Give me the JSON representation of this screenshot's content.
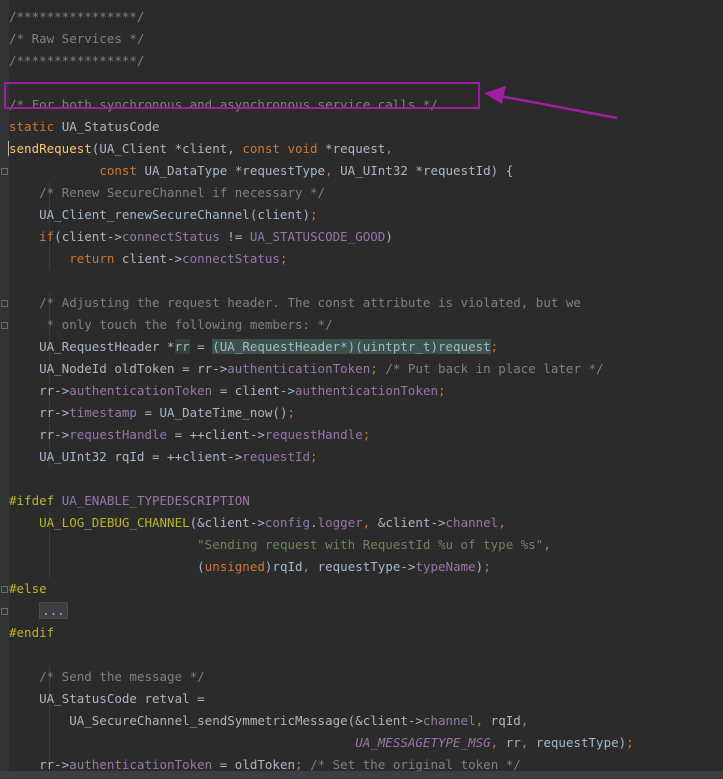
{
  "editor": {
    "lines": [
      [
        [
          "c",
          "/****************/"
        ]
      ],
      [
        [
          "c",
          "/* Raw Services */"
        ]
      ],
      [
        [
          "c",
          "/****************/"
        ]
      ],
      [],
      [
        [
          "c",
          "/* For both synchronous and asynchronous service calls */"
        ]
      ],
      [
        [
          "k",
          "static "
        ],
        [
          "t",
          "UA_StatusCode"
        ]
      ],
      [
        [
          "caret",
          ""
        ],
        [
          "fn",
          "sendRequest"
        ],
        [
          "t",
          "(UA_Client *client, "
        ],
        [
          "k",
          "const void "
        ],
        [
          "t",
          "*request"
        ],
        [
          "k",
          ","
        ]
      ],
      [
        [
          "t",
          "            "
        ],
        [
          "k",
          "const "
        ],
        [
          "t",
          "UA_DataType *requestType"
        ],
        [
          "k",
          ", "
        ],
        [
          "t",
          "UA_UInt32 *requestId) {"
        ]
      ],
      [
        [
          "t",
          "    "
        ],
        [
          "c",
          "/* Renew SecureChannel if necessary */"
        ]
      ],
      [
        [
          "t",
          "    UA_Client_renewSecureChannel(client)"
        ],
        [
          "k",
          ";"
        ]
      ],
      [
        [
          "t",
          "    "
        ],
        [
          "k",
          "if"
        ],
        [
          "t",
          "(client->"
        ],
        [
          "m",
          "connectStatus"
        ],
        [
          "t",
          " != "
        ],
        [
          "m",
          "UA_STATUSCODE_GOOD"
        ],
        [
          "t",
          ")"
        ]
      ],
      [
        [
          "t",
          "        "
        ],
        [
          "k",
          "return "
        ],
        [
          "t",
          "client->"
        ],
        [
          "m",
          "connectStatus"
        ],
        [
          "k",
          ";"
        ]
      ],
      [],
      [
        [
          "t",
          "    "
        ],
        [
          "c",
          "/* Adjusting the request header. The const attribute is violated, but we"
        ]
      ],
      [
        [
          "t",
          "    "
        ],
        [
          "c",
          " * only touch the following members: */"
        ]
      ],
      [
        [
          "t",
          "    UA_RequestHeader *"
        ],
        [
          "hl",
          "rr"
        ],
        [
          "t",
          " = "
        ],
        [
          "hl2",
          "(UA_RequestHeader*)(uintptr_t)request"
        ],
        [
          "k",
          ";"
        ]
      ],
      [
        [
          "t",
          "    UA_NodeId oldToken = rr->"
        ],
        [
          "m",
          "authenticationToken"
        ],
        [
          "k",
          "; "
        ],
        [
          "c",
          "/* Put back in place later */"
        ]
      ],
      [
        [
          "t",
          "    rr->"
        ],
        [
          "m",
          "authenticationToken"
        ],
        [
          "t",
          " = client->"
        ],
        [
          "m",
          "authenticationToken"
        ],
        [
          "k",
          ";"
        ]
      ],
      [
        [
          "t",
          "    rr->"
        ],
        [
          "m",
          "timestamp"
        ],
        [
          "t",
          " = UA_DateTime_now()"
        ],
        [
          "k",
          ";"
        ]
      ],
      [
        [
          "t",
          "    rr->"
        ],
        [
          "m",
          "requestHandle"
        ],
        [
          "t",
          " = ++client->"
        ],
        [
          "m",
          "requestHandle"
        ],
        [
          "k",
          ";"
        ]
      ],
      [
        [
          "t",
          "    UA_UInt32 rqId = ++client->"
        ],
        [
          "m",
          "requestId"
        ],
        [
          "k",
          ";"
        ]
      ],
      [],
      [
        [
          "pp",
          "#ifdef "
        ],
        [
          "m",
          "UA_ENABLE_TYPEDESCRIPTION"
        ]
      ],
      [
        [
          "t",
          "    "
        ],
        [
          "pp",
          "UA_LOG_DEBUG_CHANNEL"
        ],
        [
          "t",
          "(&client->"
        ],
        [
          "m",
          "config"
        ],
        [
          "t",
          "."
        ],
        [
          "m",
          "logger"
        ],
        [
          "k",
          ", "
        ],
        [
          "t",
          "&client->"
        ],
        [
          "m",
          "channel"
        ],
        [
          "k",
          ","
        ]
      ],
      [
        [
          "t",
          "                         "
        ],
        [
          "s",
          "\"Sending request with RequestId %u of type %s\""
        ],
        [
          "k",
          ","
        ]
      ],
      [
        [
          "t",
          "                         ("
        ],
        [
          "k",
          "unsigned"
        ],
        [
          "t",
          ")rqId"
        ],
        [
          "k",
          ", "
        ],
        [
          "t",
          "requestType->"
        ],
        [
          "m",
          "typeName"
        ],
        [
          "t",
          ")"
        ],
        [
          "k",
          ";"
        ]
      ],
      [
        [
          "pp",
          "#else"
        ]
      ],
      [
        [
          "t",
          "    "
        ],
        [
          "ell",
          "..."
        ]
      ],
      [
        [
          "pp",
          "#endif"
        ]
      ],
      [],
      [
        [
          "t",
          "    "
        ],
        [
          "c",
          "/* Send the message */"
        ]
      ],
      [
        [
          "t",
          "    UA_StatusCode retval ="
        ]
      ],
      [
        [
          "t",
          "        UA_SecureChannel_sendSymmetricMessage(&client->"
        ],
        [
          "m",
          "channel"
        ],
        [
          "k",
          ", "
        ],
        [
          "t",
          "rqId"
        ],
        [
          "k",
          ","
        ]
      ],
      [
        [
          "t",
          "                                              "
        ],
        [
          "mi",
          "UA_MESSAGETYPE_MSG"
        ],
        [
          "k",
          ", "
        ],
        [
          "t",
          "rr"
        ],
        [
          "k",
          ", "
        ],
        [
          "t",
          "requestType)"
        ],
        [
          "k",
          ";"
        ]
      ],
      [
        [
          "t",
          "    rr->"
        ],
        [
          "m",
          "authenticationToken"
        ],
        [
          "t",
          " = oldToken"
        ],
        [
          "k",
          "; "
        ],
        [
          "c",
          "/* Set the original token */"
        ]
      ]
    ]
  },
  "theme": {
    "background": "#2b2b2b",
    "comment": "#808080",
    "keyword": "#cc7832",
    "member": "#9876aa",
    "string": "#6a8759",
    "function": "#ffc66d",
    "preprocessor": "#bbb529",
    "annotation": "#a01ea0"
  },
  "annotation": {
    "shape": "box-with-arrow",
    "target_line": 5
  }
}
